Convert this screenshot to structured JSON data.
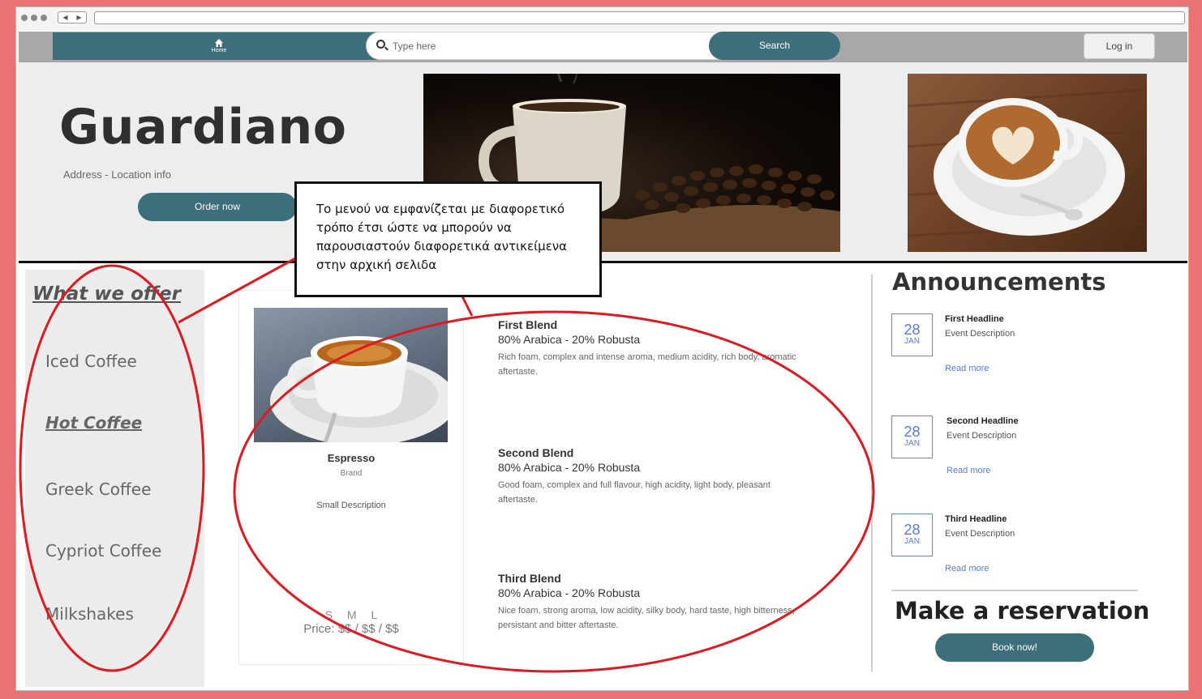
{
  "browser": {
    "nav_buttons": [
      "◀",
      "▶"
    ]
  },
  "header": {
    "home_icon": "home-icon",
    "home_label": "Home",
    "search_placeholder": "Type here",
    "search_label": "Search",
    "login_label": "Log in",
    "accent_color": "#3c6e7c"
  },
  "hero": {
    "brand": "Guardiano",
    "address": "Address - Location info",
    "order_label": "Order now"
  },
  "sidebar": {
    "title": "What we offer",
    "items": [
      {
        "label": "Iced Coffee",
        "active": false
      },
      {
        "label": "Hot Coffee",
        "active": true
      },
      {
        "label": "Greek Coffee",
        "active": false
      },
      {
        "label": "Cypriot Coffee",
        "active": false
      },
      {
        "label": "Milkshakes",
        "active": false
      }
    ]
  },
  "product": {
    "name": "Espresso",
    "brand": "Brand",
    "description": "Small Description",
    "sizes": "S M L",
    "price": "Price: $$ / $$ / $$"
  },
  "blends": [
    {
      "name": "First Blend",
      "composition": "80% Arabica - 20% Robusta",
      "description": "Rich foam, complex and intense aroma, medium acidity, rich body, aromatic aftertaste."
    },
    {
      "name": "Second Blend",
      "composition": "80% Arabica - 20% Robusta",
      "description": "Good foam, complex and full flavour, high acidity, light body, pleasant aftertaste."
    },
    {
      "name": "Third Blend",
      "composition": "80% Arabica - 20% Robusta",
      "description": "Nice foam, strong aroma, low acidity, silky body, hard taste, high bitterness, persistant and bitter aftertaste."
    }
  ],
  "announcements": {
    "title": "Announcements",
    "items": [
      {
        "day": "28",
        "month": "JAN",
        "headline": "First Headline",
        "description": "Event Description",
        "link": "Read more"
      },
      {
        "day": "28",
        "month": "JAN",
        "headline": "Second Headline",
        "description": "Event Description",
        "link": "Read more"
      },
      {
        "day": "28",
        "month": "JAN",
        "headline": "Third Headline",
        "description": "Event Description",
        "link": "Read more"
      }
    ]
  },
  "reservation": {
    "title": "Make a reservation",
    "button_label": "Book now!"
  },
  "annotation": {
    "note": "Το μενού να εμφανίζεται με διαφορετικό τρόπο έτσι ώστε να μπορούν να παρουσιαστούν διαφορετικά αντικείμενα στην αρχική σελιδα",
    "markup_color": "#e0181f"
  }
}
